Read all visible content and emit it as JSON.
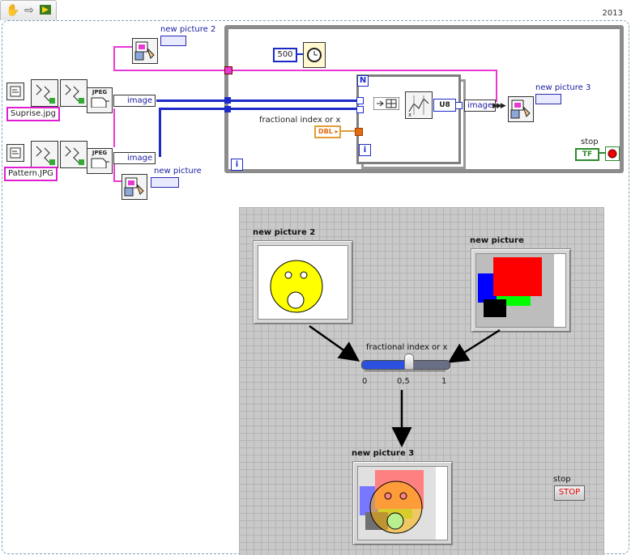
{
  "version_label": "2013",
  "toolbar": {
    "icons": [
      "hand-tool-icon",
      "arrow-icon",
      "run-icon"
    ]
  },
  "block_diagram": {
    "file_paths": [
      "Suprise.jpg",
      "Pattern.JPG"
    ],
    "jpeg_label": "JPEG",
    "image_label": "image",
    "picture_labels": {
      "top": "new picture 2",
      "bottom": "new picture",
      "right": "new picture 3"
    },
    "wait_constant": "500",
    "loop_count_label": "N",
    "iteration_label": "i",
    "fractional_label": "fractional index or x",
    "dbl_label": "DBL",
    "u8_label": "U8",
    "stop_label": "stop",
    "tf_label": "TF"
  },
  "front_panel": {
    "picture2_label": "new picture 2",
    "picture_label": "new picture",
    "picture3_label": "new picture 3",
    "slider": {
      "label": "fractional index or x",
      "ticks": [
        "0",
        "0,5",
        "1"
      ],
      "value": 0.55
    },
    "stop_label": "stop",
    "stop_button": "STOP"
  },
  "colors": {
    "wire_image": "#1c2bc8",
    "wire_picture": "#e83ad3",
    "wire_dbl": "#e49b34",
    "slider_fill": "#2c51e0"
  }
}
